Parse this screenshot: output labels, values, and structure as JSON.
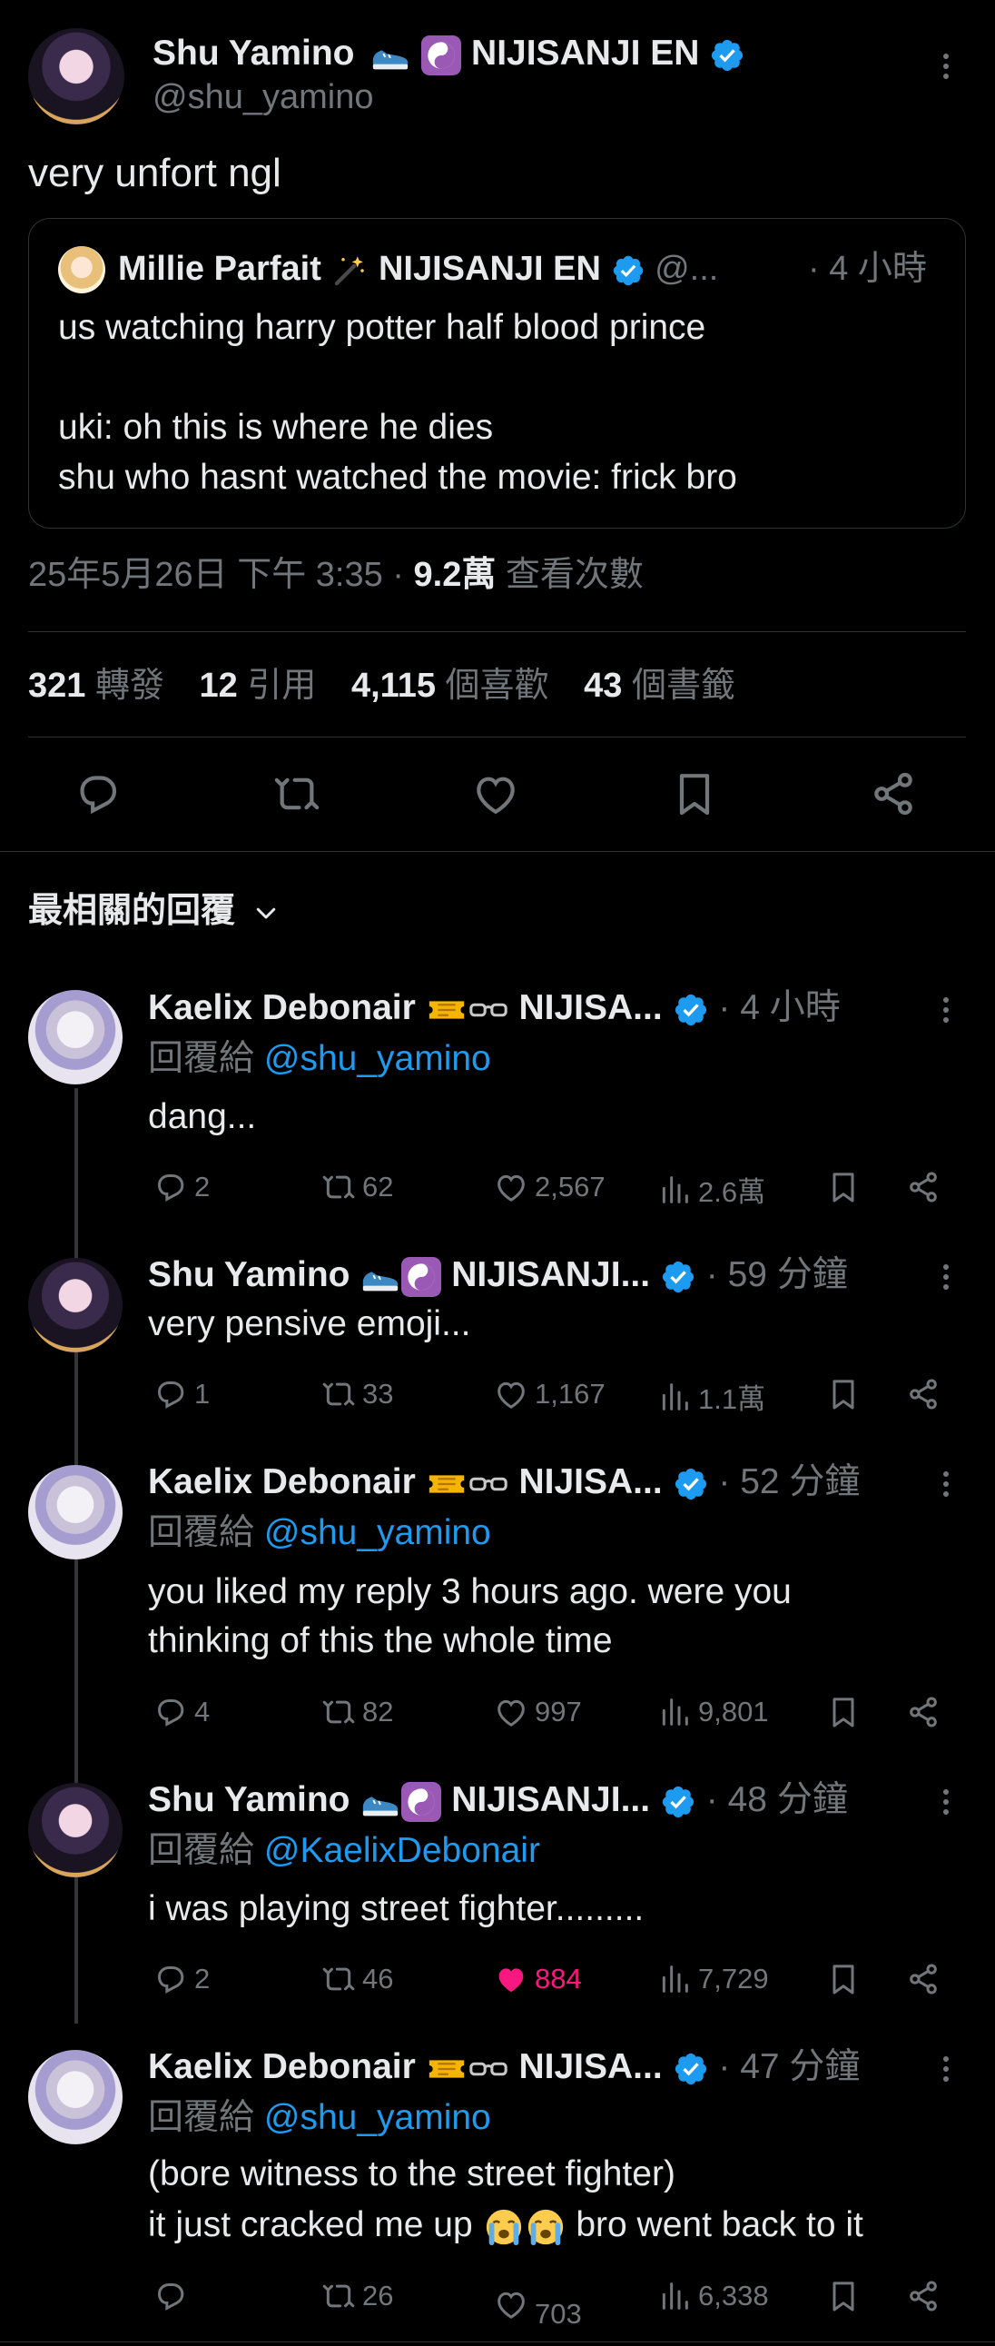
{
  "main_post": {
    "author_name": "Shu Yamino",
    "author_suffix": "NIJISANJI EN",
    "handle": "@shu_yamino",
    "text": "very unfort ngl",
    "quote": {
      "author_name": "Millie Parfait",
      "author_suffix": "NIJISANJI EN",
      "handle": "@...",
      "time": "· 4 小時",
      "lines": [
        "us watching harry potter half blood prince",
        "uki: oh this is where he dies",
        "shu who hasnt watched the movie: frick bro"
      ]
    },
    "timestamp": "25年5月26日 下午 3:35 ·",
    "views_value": "9.2萬",
    "views_label": "查看次數",
    "stats": {
      "reposts_value": "321",
      "reposts_label": "轉發",
      "quotes_value": "12",
      "quotes_label": "引用",
      "likes_value": "4,115",
      "likes_label": "個喜歡",
      "bookmarks_value": "43",
      "bookmarks_label": "個書籤"
    }
  },
  "replies_header": "最相關的回覆",
  "replies": [
    {
      "author": "Kaelix Debonair",
      "suffix": "NIJISA...",
      "time": "· 4 小時",
      "reply_prefix": "回覆給",
      "reply_to": "@shu_yamino",
      "lines": [
        "dang..."
      ],
      "replies": "2",
      "reposts": "62",
      "likes": "2,567",
      "views": "2.6萬"
    },
    {
      "author": "Shu Yamino",
      "suffix": "NIJISANJI...",
      "time": "· 59 分鐘",
      "reply_prefix": "",
      "reply_to": "",
      "lines": [
        "very pensive emoji..."
      ],
      "replies": "1",
      "reposts": "33",
      "likes": "1,167",
      "views": "1.1萬"
    },
    {
      "author": "Kaelix Debonair",
      "suffix": "NIJISA...",
      "time": "· 52 分鐘",
      "reply_prefix": "回覆給",
      "reply_to": "@shu_yamino",
      "lines": [
        "you liked my reply 3 hours ago. were you",
        "thinking of this the whole time"
      ],
      "replies": "4",
      "reposts": "82",
      "likes": "997",
      "views": "9,801"
    },
    {
      "author": "Shu Yamino",
      "suffix": "NIJISANJI...",
      "time": "· 48 分鐘",
      "reply_prefix": "回覆給",
      "reply_to": "@KaelixDebonair",
      "lines": [
        "i was playing street fighter........."
      ],
      "replies": "2",
      "reposts": "46",
      "likes": "884",
      "views": "7,729"
    },
    {
      "author": "Kaelix Debonair",
      "suffix": "NIJISA...",
      "time": "· 47 分鐘",
      "reply_prefix": "回覆給",
      "reply_to": "@shu_yamino",
      "lines": [
        "(bore witness to the street fighter)",
        "it just cracked me up",
        "bro went back to it"
      ],
      "replies": "",
      "reposts": "26",
      "likes": "703",
      "views": "6,338"
    }
  ],
  "colors": {
    "background": "#000000",
    "text": "#e7e9ea",
    "muted": "#71767b",
    "link": "#1d9bf0",
    "verified": "#1d9bf0",
    "liked": "#f91880",
    "divider": "#2f3336"
  },
  "icons": [
    "more-icon",
    "verified-icon",
    "sneaker-emoji",
    "yin-yang-emoji",
    "magic-wand-emoji",
    "ticket-emoji",
    "glasses-emoji",
    "loudly-crying-emoji",
    "reply-icon",
    "repost-icon",
    "like-icon",
    "views-icon",
    "bookmark-icon",
    "share-icon",
    "chevron-down-icon"
  ]
}
